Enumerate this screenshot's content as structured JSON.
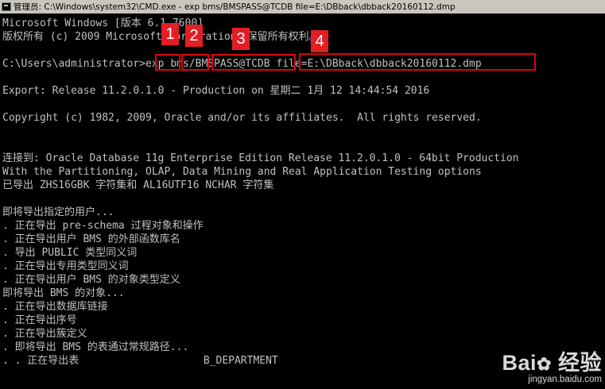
{
  "window": {
    "title": "管理员: C:\\Windows\\system32\\CMD.exe - exp  bms/BMSPASS@TCDB file=E:\\DBback\\dbback20160112.dmp"
  },
  "console": {
    "lines": [
      "Microsoft Windows [版本 6.1.7600]",
      "版权所有 (c) 2009 Microsoft Corporation。保留所有权利。",
      "",
      "C:\\Users\\administrator>exp bms/BMSPASS@TCDB file=E:\\DBback\\dbback20160112.dmp",
      "",
      "Export: Release 11.2.0.1.0 - Production on 星期二 1月 12 14:44:54 2016",
      "",
      "Copyright (c) 1982, 2009, Oracle and/or its affiliates.  All rights reserved.",
      "",
      "",
      "连接到: Oracle Database 11g Enterprise Edition Release 11.2.0.1.0 - 64bit Production",
      "With the Partitioning, OLAP, Data Mining and Real Application Testing options",
      "已导出 ZHS16GBK 字符集和 AL16UTF16 NCHAR 字符集",
      "",
      "即将导出指定的用户...",
      ". 正在导出 pre-schema 过程对象和操作",
      ". 正在导出用户 BMS 的外部函数库名",
      ". 导出 PUBLIC 类型同义词",
      ". 正在导出专用类型同义词",
      ". 正在导出用户 BMS 的对象类型定义",
      "即将导出 BMS 的对象...",
      ". 正在导出数据库链接",
      ". 正在导出序号",
      ". 正在导出簇定义",
      ". 即将导出 BMS 的表通过常规路径...",
      ". . 正在导出表                    B_DEPARTMENT"
    ]
  },
  "annotations": {
    "badges": [
      "1",
      "2",
      "3",
      "4"
    ]
  },
  "watermark": {
    "brand": "Bai",
    "brand_suffix": "经验",
    "url": "jingyan.baidu.com"
  }
}
